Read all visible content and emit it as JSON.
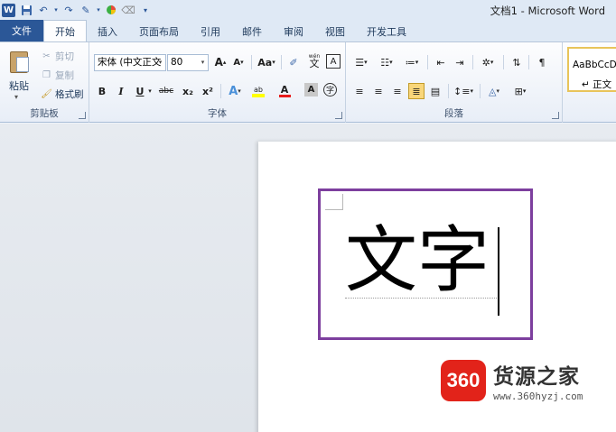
{
  "window": {
    "title": "文档1 - Microsoft Word",
    "app_icon": "W"
  },
  "qat": {
    "icons": [
      "word-icon",
      "save-icon",
      "undo-icon",
      "redo-icon",
      "format-painter-icon",
      "color-icon",
      "clear-icon",
      "customize-icon"
    ]
  },
  "tabs": {
    "file": "文件",
    "items": [
      "开始",
      "插入",
      "页面布局",
      "引用",
      "邮件",
      "审阅",
      "视图",
      "开发工具"
    ]
  },
  "clipboard": {
    "paste": "粘贴",
    "cut": "剪切",
    "copy": "复制",
    "format_painter": "格式刷",
    "label": "剪贴板"
  },
  "font": {
    "name": "宋体 (中文正文",
    "size": "80",
    "label": "字体",
    "grow": "A",
    "shrink": "A",
    "change_case": "Aa",
    "bold": "B",
    "italic": "I",
    "underline": "U",
    "strike": "abc",
    "subscript": "x₂",
    "superscript": "x²",
    "text_effect": "A",
    "highlight": "ab",
    "font_color": "A",
    "char_shading": "A",
    "enclose": "字",
    "phonetic": "wén",
    "phonetic_base": "文",
    "border": "A"
  },
  "paragraph": {
    "label": "段落"
  },
  "styles": {
    "sample": "AaBbCcDc",
    "name": "正文"
  },
  "document": {
    "text": "文字"
  },
  "watermark": {
    "badge": "360",
    "name": "货源之家",
    "url": "www.360hyzj.com"
  },
  "colors": {
    "accent_file_tab": "#2b5797",
    "highlight_box": "#7d3f9e",
    "brand_red": "#e2231a"
  }
}
